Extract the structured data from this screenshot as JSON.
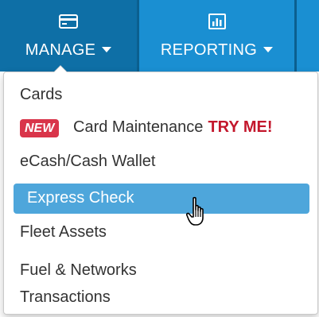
{
  "navbar": {
    "items": [
      {
        "label": "MANAGE",
        "icon": "credit-card-icon"
      },
      {
        "label": "REPORTING",
        "icon": "bar-chart-icon"
      }
    ]
  },
  "menu": {
    "items": [
      {
        "label": "Cards"
      },
      {
        "badge": "NEW",
        "label": "Card Maintenance",
        "cta": "TRY ME!"
      },
      {
        "label": "eCash/Cash Wallet"
      },
      {
        "label": "Express Check",
        "state": "hovered"
      },
      {
        "label": "Fleet Assets"
      },
      {
        "label": "Fuel & Networks Transactions"
      }
    ]
  },
  "colors": {
    "nav_bg": "#1c91d4",
    "nav_active_bg": "#0e6fa6",
    "highlight": "#4ea6db",
    "badge": "#d9354a",
    "cta": "#c3172c"
  },
  "cursor": {
    "icon": "hand-pointer-icon"
  }
}
